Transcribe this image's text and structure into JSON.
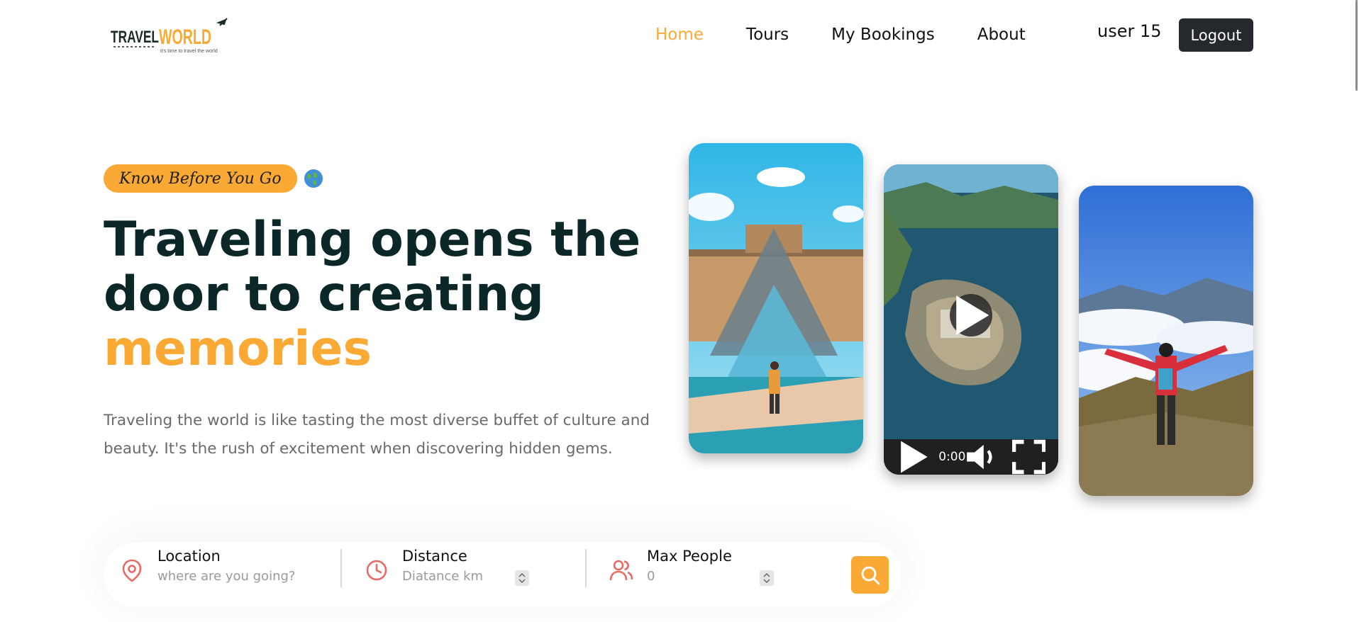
{
  "brand": {
    "logo_text": "TRAVELWORLD",
    "tagline": "it's time to travel the world"
  },
  "nav": {
    "items": [
      {
        "label": "Home",
        "active": true
      },
      {
        "label": "Tours",
        "active": false
      },
      {
        "label": "My Bookings",
        "active": false
      },
      {
        "label": "About",
        "active": false
      }
    ]
  },
  "user": {
    "name": "user 15",
    "logout_label": "Logout"
  },
  "hero": {
    "tag": "Know Before You Go",
    "tag_icon": "globe-icon",
    "title_line1": "Traveling opens the",
    "title_line2": "door to creating",
    "title_highlight": "memories",
    "description": "Traveling the world is like tasting the most diverse buffet of culture and beauty. It's the rush of excitement when discovering hidden gems."
  },
  "video": {
    "time": "0:00"
  },
  "search": {
    "location_label": "Location",
    "location_placeholder": "where are you going?",
    "distance_label": "Distance",
    "distance_placeholder": "Diatance km",
    "people_label": "Max People",
    "people_placeholder": "0"
  },
  "colors": {
    "accent": "#faa935",
    "heading": "#0b2727",
    "icon_red": "#e96a64",
    "button_dark": "#25282c"
  }
}
